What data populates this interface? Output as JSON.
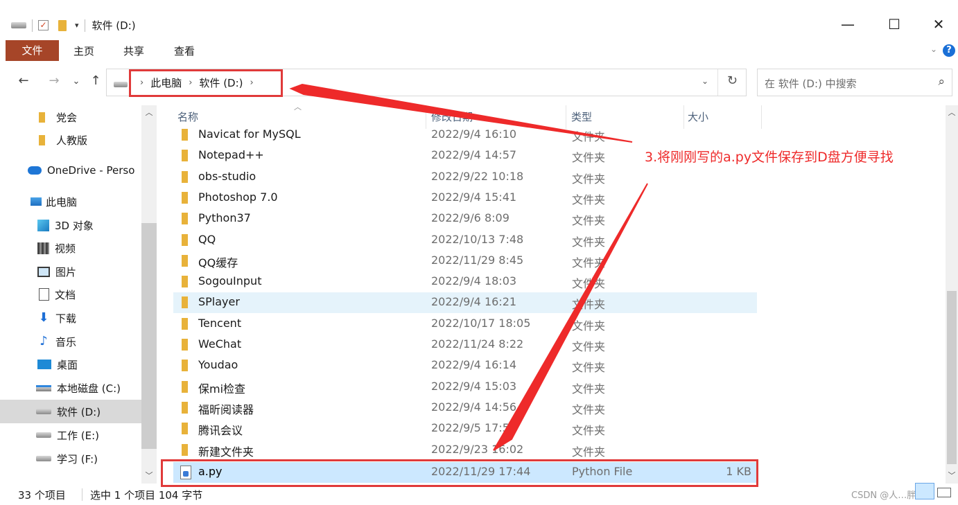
{
  "window": {
    "title": "软件 (D:)",
    "minimize": "—",
    "maximize": "☐",
    "close": "✕"
  },
  "quick_access": {
    "dropdown": "▾"
  },
  "ribbon": {
    "tabs": [
      "文件",
      "主页",
      "共享",
      "查看"
    ],
    "collapse": "⌄",
    "help": "?"
  },
  "navigation": {
    "back": "←",
    "forward": "→",
    "recent": "⌄",
    "up": "↑"
  },
  "address": {
    "crumbs": [
      "此电脑",
      "软件 (D:)"
    ],
    "separator": "›",
    "dropdown": "⌄",
    "refresh": "↻"
  },
  "search": {
    "placeholder": "在 软件 (D:) 中搜索",
    "icon": "⌕"
  },
  "sidebar": {
    "items": [
      {
        "label": "党会",
        "icon": "folder-icon"
      },
      {
        "label": "人教版",
        "icon": "folder-icon"
      },
      {
        "label": "OneDrive - Perso",
        "icon": "onedrive-icon"
      },
      {
        "label": "此电脑",
        "icon": "this-pc-icon"
      },
      {
        "label": "3D 对象",
        "icon": "3d-objects-icon"
      },
      {
        "label": "视频",
        "icon": "videos-icon"
      },
      {
        "label": "图片",
        "icon": "pictures-icon"
      },
      {
        "label": "文档",
        "icon": "documents-icon"
      },
      {
        "label": "下载",
        "icon": "downloads-icon"
      },
      {
        "label": "音乐",
        "icon": "music-icon"
      },
      {
        "label": "桌面",
        "icon": "desktop-icon"
      },
      {
        "label": "本地磁盘 (C:)",
        "icon": "windows-drive-icon"
      },
      {
        "label": "软件 (D:)",
        "icon": "drive-icon",
        "selected": true
      },
      {
        "label": "工作 (E:)",
        "icon": "drive-icon"
      },
      {
        "label": "学习 (F:)",
        "icon": "drive-icon"
      }
    ],
    "scroll_up": "︿",
    "scroll_down": "﹀"
  },
  "columns": {
    "name": "名称",
    "date": "修改日期",
    "type": "类型",
    "size": "大小",
    "sort_indicator": "︿"
  },
  "files": [
    {
      "name": "Navicat for MySQL",
      "date": "2022/9/4 16:10",
      "type": "文件夹",
      "size": ""
    },
    {
      "name": "Notepad++",
      "date": "2022/9/4 14:57",
      "type": "文件夹",
      "size": ""
    },
    {
      "name": "obs-studio",
      "date": "2022/9/22 10:18",
      "type": "文件夹",
      "size": ""
    },
    {
      "name": "Photoshop 7.0",
      "date": "2022/9/4 15:41",
      "type": "文件夹",
      "size": ""
    },
    {
      "name": "Python37",
      "date": "2022/9/6 8:09",
      "type": "文件夹",
      "size": ""
    },
    {
      "name": "QQ",
      "date": "2022/10/13 7:48",
      "type": "文件夹",
      "size": ""
    },
    {
      "name": "QQ缓存",
      "date": "2022/11/29 8:45",
      "type": "文件夹",
      "size": ""
    },
    {
      "name": "SogouInput",
      "date": "2022/9/4 18:03",
      "type": "文件夹",
      "size": ""
    },
    {
      "name": "SPlayer",
      "date": "2022/9/4 16:21",
      "type": "文件夹",
      "size": "",
      "hover": true
    },
    {
      "name": "Tencent",
      "date": "2022/10/17 18:05",
      "type": "文件夹",
      "size": ""
    },
    {
      "name": "WeChat",
      "date": "2022/11/24 8:22",
      "type": "文件夹",
      "size": ""
    },
    {
      "name": "Youdao",
      "date": "2022/9/4 16:14",
      "type": "文件夹",
      "size": ""
    },
    {
      "name": "保mi检查",
      "date": "2022/9/4 15:03",
      "type": "文件夹",
      "size": ""
    },
    {
      "name": "福昕阅读器",
      "date": "2022/9/4 14:56",
      "type": "文件夹",
      "size": ""
    },
    {
      "name": "腾讯会议",
      "date": "2022/9/5 17:55",
      "type": "文件夹",
      "size": ""
    },
    {
      "name": "新建文件夹",
      "date": "2022/9/23 16:02",
      "type": "文件夹",
      "size": ""
    },
    {
      "name": "a.py",
      "date": "2022/11/29 17:44",
      "type": "Python File",
      "size": "1 KB",
      "selected": true,
      "icon": "python-file-icon"
    }
  ],
  "annotation": {
    "text": "3.将刚刚写的a.py文件保存到D盘方便寻找",
    "color": "#ee2a2a"
  },
  "status": {
    "item_count": "33 个项目",
    "selection": "选中 1 个项目  104 字节",
    "watermark": "CSDN @人…胖子"
  },
  "colors": {
    "file_tab": "#a64528",
    "selection": "#cce8ff",
    "highlight_box": "#e03a3a"
  }
}
